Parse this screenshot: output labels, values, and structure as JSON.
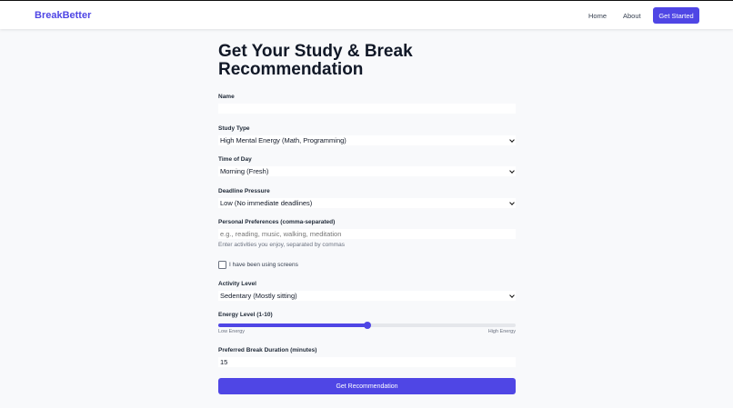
{
  "nav": {
    "brand": "BreakBetter",
    "links": [
      {
        "label": "Home"
      },
      {
        "label": "About"
      }
    ],
    "cta": "Get Started"
  },
  "colors": {
    "accent": "#4f46e5",
    "background": "#f8f9fb"
  },
  "form": {
    "title": "Get Your Study & Break Recommendation",
    "name": {
      "label": "Name",
      "value": ""
    },
    "study_type": {
      "label": "Study Type",
      "value": "High Mental Energy (Math, Programming)"
    },
    "time_of_day": {
      "label": "Time of Day",
      "value": "Morning (Fresh)"
    },
    "deadline": {
      "label": "Deadline Pressure",
      "value": "Low (No immediate deadlines)"
    },
    "preferences": {
      "label": "Personal Preferences (comma-separated)",
      "placeholder": "e.g., reading, music, walking, meditation",
      "hint": "Enter activities you enjoy, separated by commas"
    },
    "screens": {
      "label": "I have been using screens",
      "checked": false
    },
    "activity": {
      "label": "Activity Level",
      "value": "Sedentary (Mostly sitting)"
    },
    "energy": {
      "label": "Energy Level (1-10)",
      "min": 1,
      "max": 10,
      "value": 5.5,
      "low_label": "Low Energy",
      "high_label": "High Energy"
    },
    "break_duration": {
      "label": "Preferred Break Duration (minutes)",
      "value": "15"
    },
    "submit": "Get Recommendation"
  }
}
